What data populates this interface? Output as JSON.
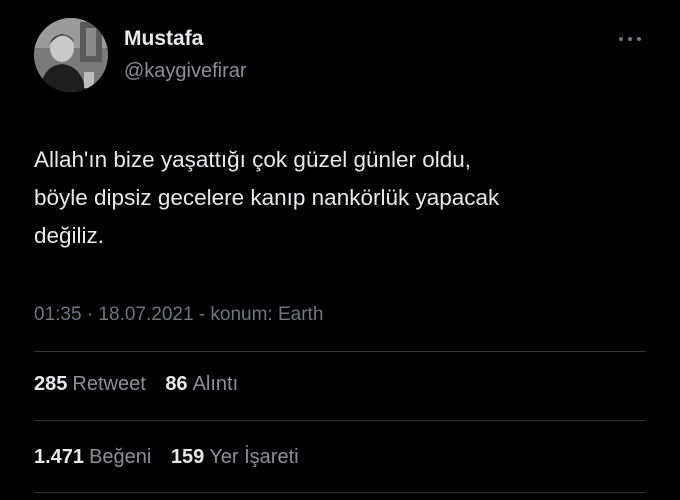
{
  "author": {
    "name": "Mustafa",
    "handle": "@kaygivefirar",
    "avatar_icon": "profile-photo"
  },
  "tweet": {
    "lines": [
      "Allah'ın bize yaşattığı çok güzel günler oldu,",
      "böyle dipsiz gecelere kanıp nankörlük yapacak",
      "değiliz."
    ],
    "meta": "01:35 · 18.07.2021 - konum: Earth"
  },
  "stats": {
    "retweets": {
      "count": "285",
      "label": "Retweet"
    },
    "quotes": {
      "count": "86",
      "label": "Alıntı"
    },
    "likes": {
      "count": "1.471",
      "label": "Beğeni"
    },
    "bookmarks": {
      "count": "159",
      "label": "Yer İşareti"
    }
  },
  "colors": {
    "background": "#000000",
    "primary_text": "#e7e9ea",
    "secondary_text": "#8b9096",
    "divider": "#2f3336"
  },
  "more_icon": "ellipsis-icon"
}
